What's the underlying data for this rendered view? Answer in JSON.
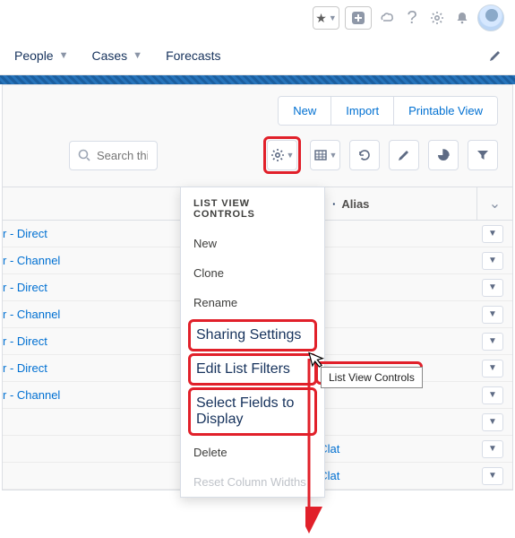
{
  "topbar": {
    "star_icon": "star",
    "plus_icon": "plus",
    "checker_icon": "checker",
    "help_icon": "help",
    "gear_icon": "gear",
    "bell_icon": "bell",
    "avatar": "avatar"
  },
  "nav": {
    "items": [
      "People",
      "Cases",
      "Forecasts"
    ]
  },
  "actions": {
    "buttons": [
      "New",
      "Import",
      "Printable View"
    ]
  },
  "search": {
    "placeholder": "Search this list..."
  },
  "toolbar_icons": {
    "gear": "gear",
    "table": "table",
    "refresh": "refresh",
    "edit": "edit",
    "chart": "chart",
    "filter": "filter"
  },
  "columns": {
    "alias": "Alias"
  },
  "dropdown": {
    "title": "LIST VIEW CONTROLS",
    "items": [
      "New",
      "Clone",
      "Rename",
      "Sharing Settings",
      "Edit List Filters",
      "Select Fields to Display",
      "Delete",
      "Reset Column Widths"
    ]
  },
  "tooltip": "List View Controls",
  "rows": [
    {
      "name_suffix": "r - Direct",
      "alias": ""
    },
    {
      "name_suffix": "r - Channel",
      "alias": ""
    },
    {
      "name_suffix": "r - Direct",
      "alias": ""
    },
    {
      "name_suffix": "r - Channel",
      "alias": ""
    },
    {
      "name_suffix": "r - Direct",
      "alias": ""
    },
    {
      "name_suffix": "r - Direct",
      "alias": ""
    },
    {
      "name_suffix": "r - Channel",
      "alias": ""
    },
    {
      "name_suffix": "",
      "alias": ""
    },
    {
      "name_suffix": "",
      "alias": "JClat"
    },
    {
      "name_suffix": "",
      "alias": "JClat"
    }
  ],
  "highlights": {
    "gear_button": true,
    "sharing_edit_select_block": true,
    "tooltip_box": true,
    "arrow_color": "#e1202a"
  }
}
